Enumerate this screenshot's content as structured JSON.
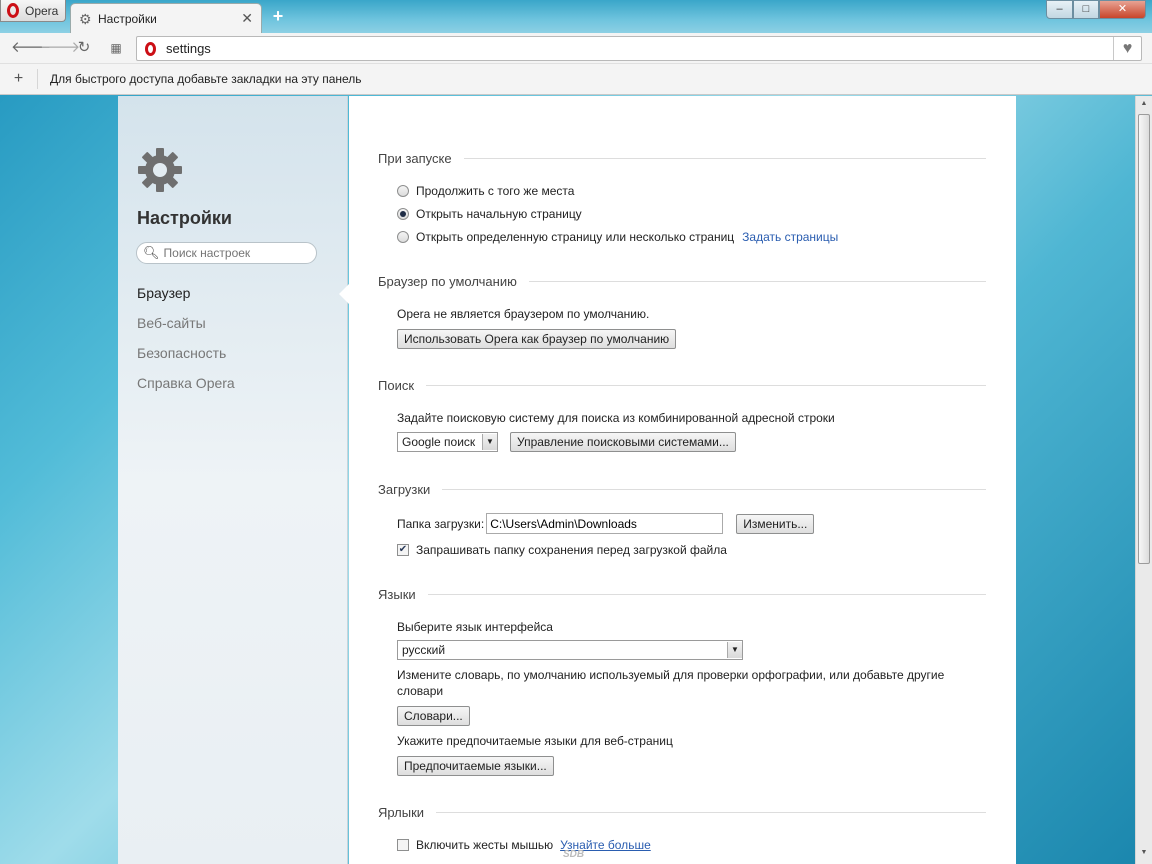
{
  "window": {
    "opera_button": "Opera",
    "tab_title": "Настройки",
    "controls": [
      "–",
      "□",
      "✕"
    ]
  },
  "toolbar": {
    "url": "settings"
  },
  "bookmarks_bar": {
    "hint": "Для быстрого доступа добавьте закладки на эту панель"
  },
  "sidebar": {
    "title": "Настройки",
    "search_placeholder": "Поиск настроек",
    "nav": [
      "Браузер",
      "Веб-сайты",
      "Безопасность",
      "Справка Opera"
    ]
  },
  "startup": {
    "heading": "При запуске",
    "options": [
      "Продолжить с того же места",
      "Открыть начальную страницу",
      "Открыть определенную страницу или несколько страниц"
    ],
    "selected": "Открыть начальную страницу",
    "set_pages_link": "Задать страницы"
  },
  "default_browser": {
    "heading": "Браузер по умолчанию",
    "status": "Opera не является браузером по умолчанию.",
    "make_default_button": "Использовать Opera как браузер по умолчанию"
  },
  "search": {
    "heading": "Поиск",
    "description": "Задайте поисковую систему для поиска из комбинированной адресной строки",
    "engine": "Google поиск",
    "manage_button": "Управление поисковыми системами..."
  },
  "downloads": {
    "heading": "Загрузки",
    "folder_label": "Папка загрузки:",
    "folder_path": "C:\\Users\\Admin\\Downloads",
    "change_button": "Изменить...",
    "ask_label": "Запрашивать папку сохранения перед загрузкой файла",
    "ask_checked": true
  },
  "languages": {
    "heading": "Языки",
    "ui_label": "Выберите язык интерфейса",
    "ui_language": "русский",
    "dict_description_1": "Измените словарь, по умолчанию используемый для проверки орфографии, или добавьте другие",
    "dict_description_2": "словари",
    "dict_button": "Словари...",
    "preferred_label": "Укажите предпочитаемые языки для веб-страниц",
    "preferred_button": "Предпочитаемые языки..."
  },
  "shortcuts": {
    "heading": "Ярлыки",
    "mouse_gestures_label": "Включить жесты мышью",
    "mouse_gestures_checked": false,
    "learn_more_link": "Узнайте больше"
  },
  "watermark": "SDB"
}
